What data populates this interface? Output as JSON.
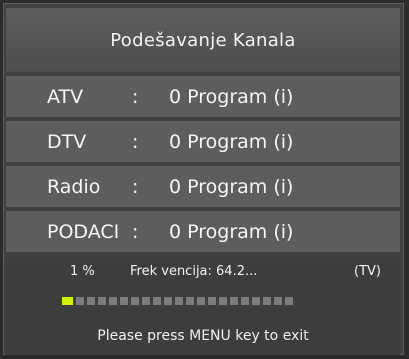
{
  "title": "Podešavanje Kanala",
  "channels": [
    {
      "label": "ATV",
      "colon": ":",
      "value": "0 Program (i)"
    },
    {
      "label": "DTV",
      "colon": ":",
      "value": "0 Program (i)"
    },
    {
      "label": "Radio",
      "colon": ":",
      "value": "0 Program (i)"
    },
    {
      "label": "PODACI",
      "colon": ":",
      "value": "0 Program (i)"
    }
  ],
  "status": {
    "percent": "1  %",
    "frequency": "Frek vencija: 64.2...",
    "mode": "(TV)"
  },
  "progress": {
    "fraction": 0.01,
    "segments_total": 21,
    "segments_filled": 1
  },
  "exit_message": "Please press MENU key to exit",
  "colors": {
    "accent": "#d5f000",
    "row_bg": "#5c5e5d",
    "bg": "#3f4140"
  }
}
